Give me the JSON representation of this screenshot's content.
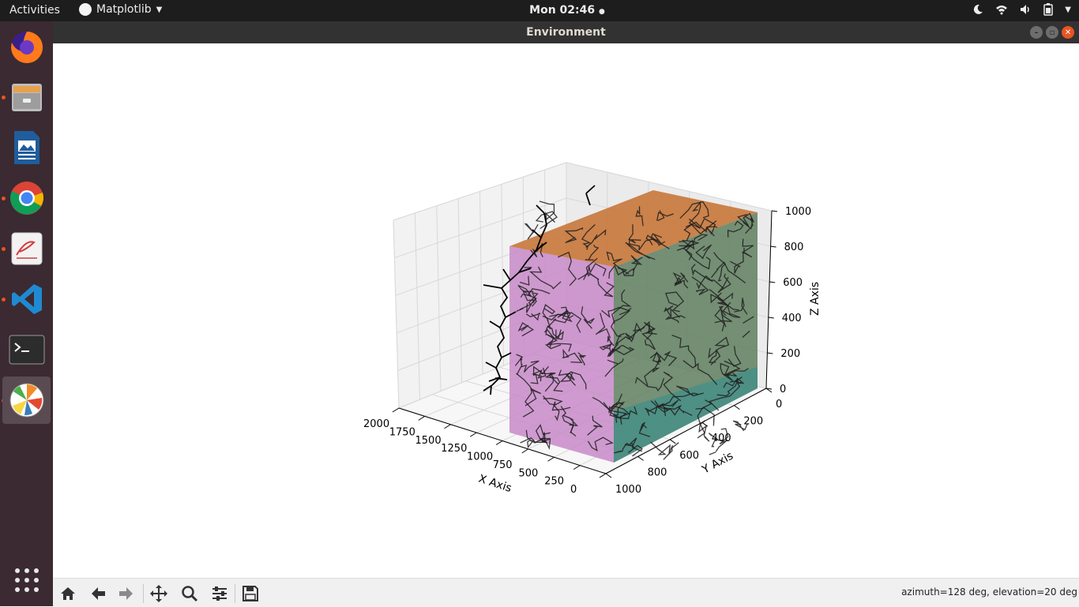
{
  "topbar": {
    "activities": "Activities",
    "app_name": "Matplotlib",
    "clock": "Mon 02:46"
  },
  "dock": {
    "items": [
      "firefox-icon",
      "files-icon",
      "writer-icon",
      "chrome-icon",
      "evince-icon",
      "vscode-icon",
      "terminal-icon",
      "matplotlib-icon"
    ]
  },
  "window": {
    "title": "Environment"
  },
  "chart_data": {
    "type": "3d",
    "xlabel": "X Axis",
    "ylabel": "Y Axis",
    "zlabel": "Z Axis",
    "xticks": [
      "2000",
      "1750",
      "1500",
      "1250",
      "1000",
      "750",
      "500",
      "250",
      "0"
    ],
    "yticks": [
      "0",
      "200",
      "400",
      "600",
      "800",
      "1000"
    ],
    "zticks": [
      "0",
      "200",
      "400",
      "600",
      "800",
      "1000"
    ],
    "xlim": [
      0,
      2000
    ],
    "ylim": [
      0,
      1000
    ],
    "zlim": [
      0,
      1000
    ],
    "grid": true,
    "view": {
      "azimuth": 128,
      "elevation": 20
    },
    "colors": {
      "top_face": "#c8773a",
      "front_face": "#c88ac8",
      "side_face": "#5f7f5f",
      "bottom_face": "#2e8f8f",
      "tree_lines": "#000000"
    }
  },
  "toolbar": {
    "buttons": [
      "home-icon",
      "back-icon",
      "forward-icon",
      "pan-icon",
      "zoom-icon",
      "configure-icon",
      "save-icon"
    ],
    "status": "azimuth=128 deg, elevation=20 deg"
  }
}
